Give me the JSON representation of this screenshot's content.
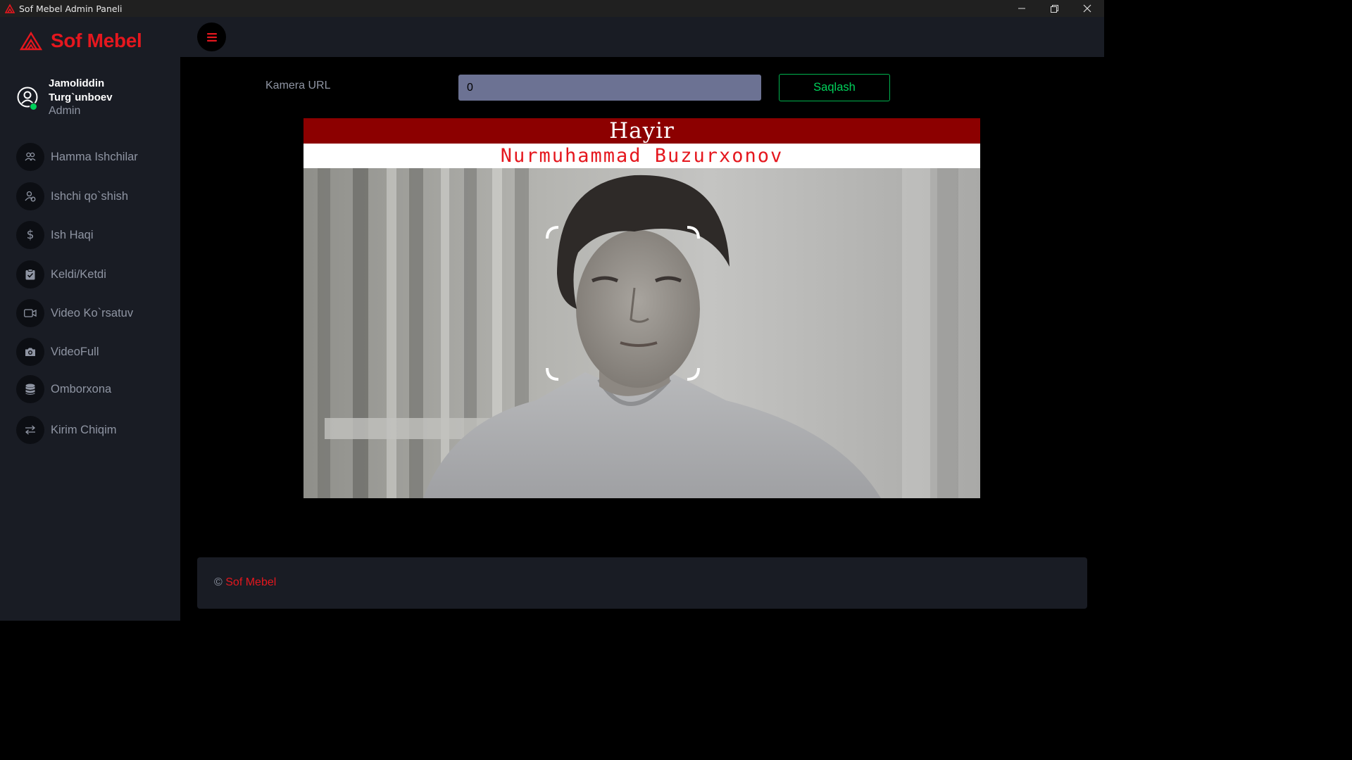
{
  "window": {
    "title": "Sof Mebel Admin Paneli"
  },
  "brand": {
    "name": "Sof Mebel",
    "accent": "#e5171e"
  },
  "profile": {
    "name": "Jamoliddin Turg`unboev",
    "role": "Admin",
    "status_color": "#00d25b"
  },
  "sidebar": {
    "items": [
      {
        "label": "Hamma Ishchilar",
        "icon": "users-icon"
      },
      {
        "label": "Ishchi qo`shish",
        "icon": "user-add-icon"
      },
      {
        "label": "Ish Haqi",
        "icon": "dollar-icon"
      },
      {
        "label": "Keldi/Ketdi",
        "icon": "clipboard-icon"
      },
      {
        "label": "Video Ko`rsatuv",
        "icon": "video-camera-icon"
      },
      {
        "label": "VideoFull",
        "icon": "camera-icon"
      },
      {
        "label": "Omborxona",
        "icon": "database-icon"
      },
      {
        "label": "Kirim Chiqim",
        "icon": "swap-arrows-icon"
      }
    ]
  },
  "camera": {
    "label": "Kamera URL",
    "value": "0",
    "save_label": "Saqlash"
  },
  "video_feed": {
    "status_text": "Hayir",
    "status_color": "#8c0000",
    "person_name": "Nurmuhammad Buzurxonov"
  },
  "footer": {
    "copyright_symbol": "©",
    "brand": "Sof Mebel"
  }
}
